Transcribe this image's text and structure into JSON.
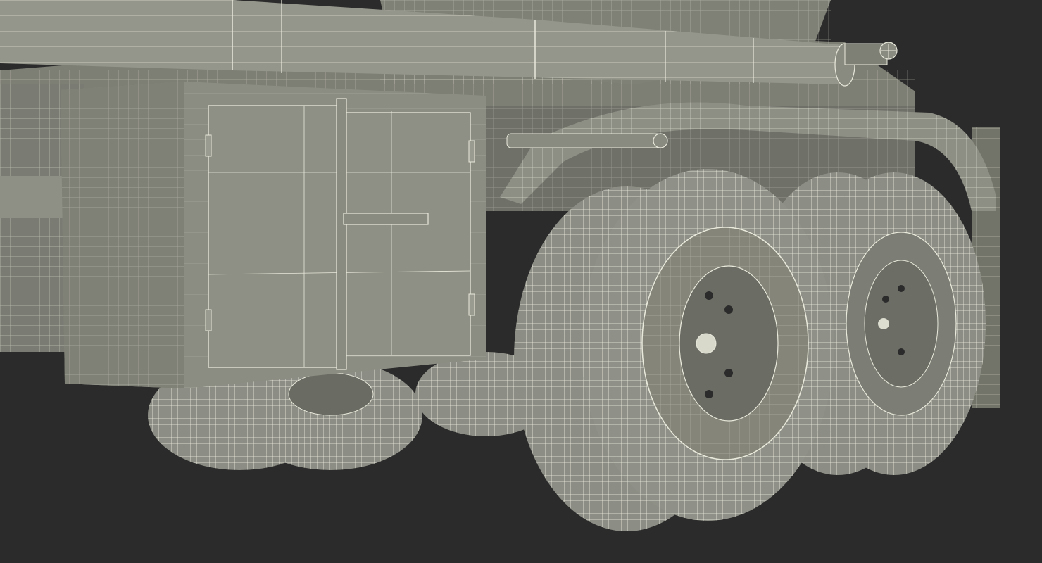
{
  "scene": {
    "subject": "truck-rear-wireframe-render",
    "colors": {
      "background": "#2b2b2b",
      "body": "#8a8b80",
      "body_light": "#9a9b90",
      "body_dark": "#6e6f66",
      "wire": "#e9e9dc",
      "tire": "#8c8d84",
      "tire_dark": "#5f605a",
      "shadow": "#3a3a37"
    }
  }
}
